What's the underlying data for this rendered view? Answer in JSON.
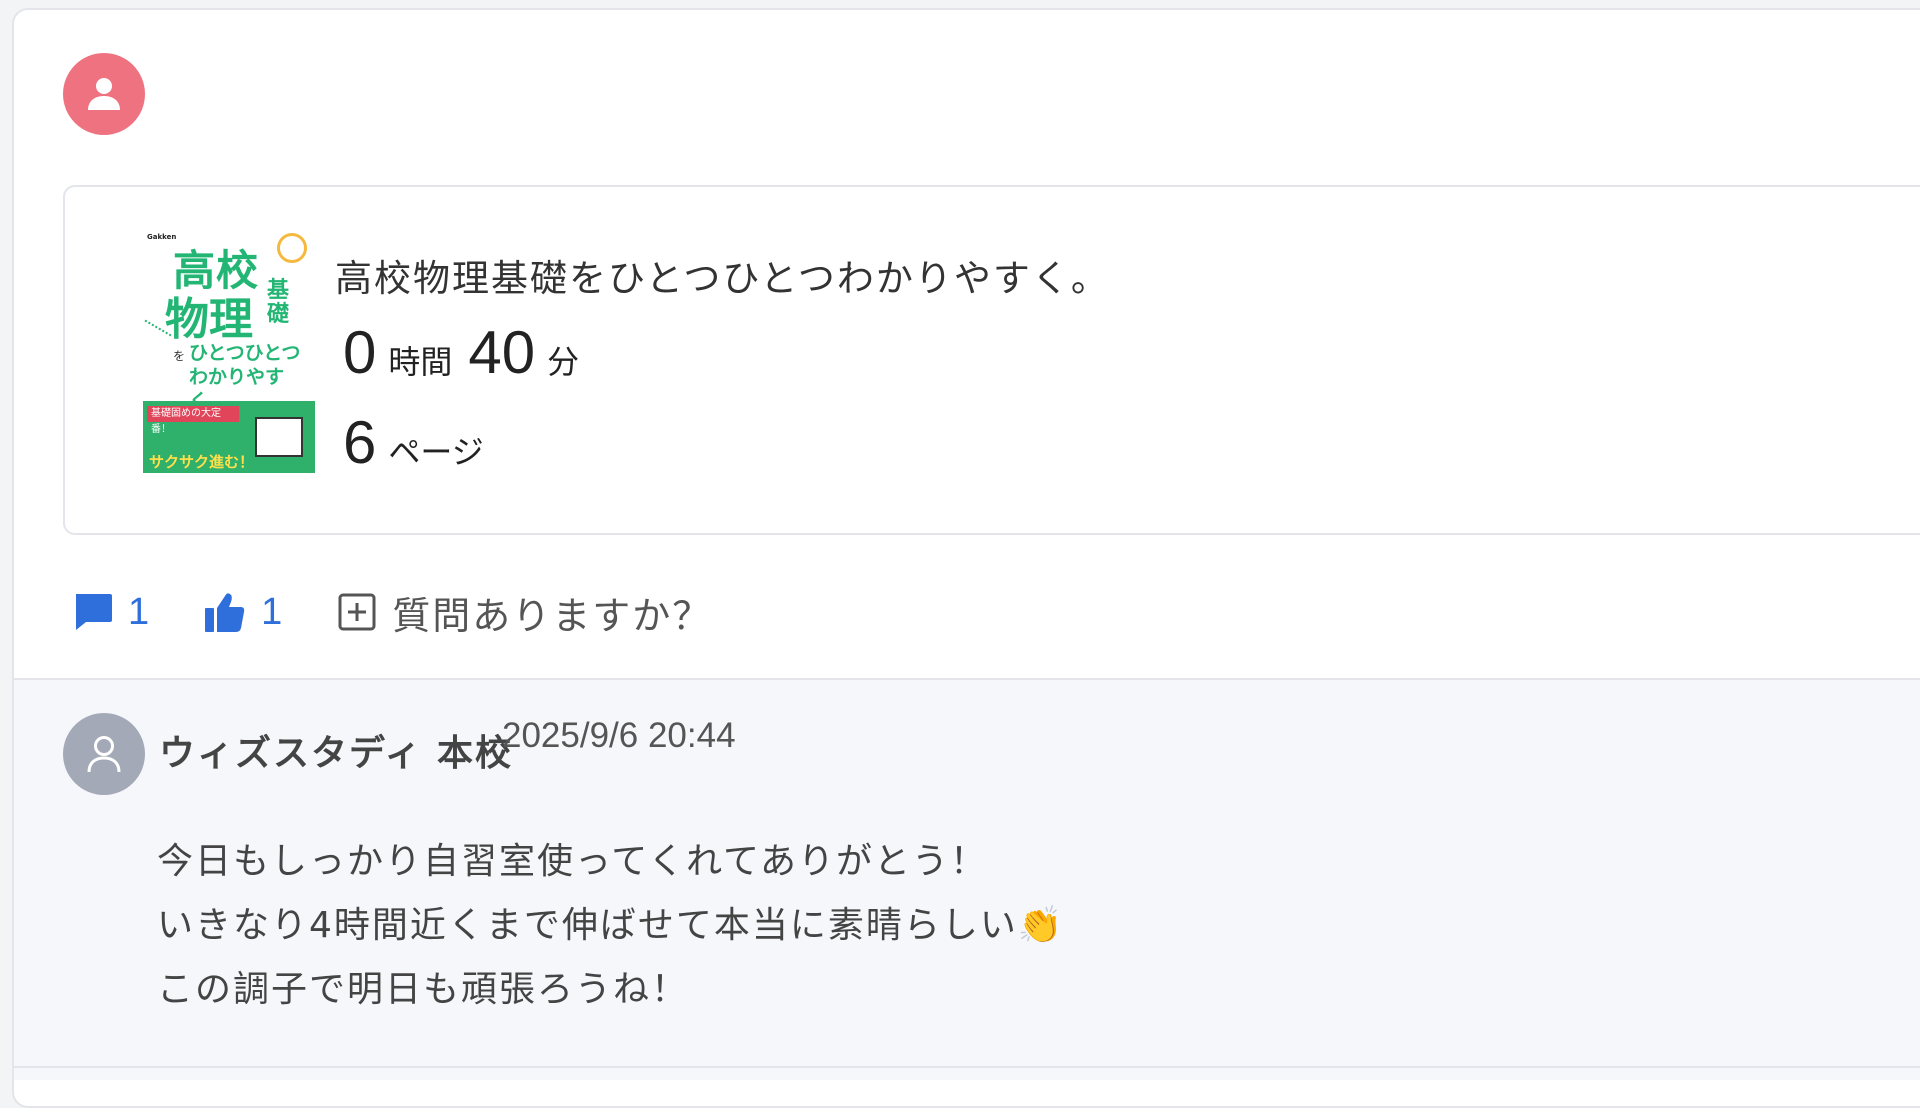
{
  "post": {
    "avatar_icon": "user-icon",
    "avatar_color": "#ee7280"
  },
  "record": {
    "book_cover": {
      "publisher": "Gakken",
      "title_line1": "高校",
      "title_line2": "物理",
      "title_suffix": "基礎",
      "particle": "を",
      "subtitle_line1": "ひとつひとつ",
      "subtitle_line2": "わかりやすく。",
      "band_tag": "基礎固めの大定番！",
      "band_text": "サクサク進む！"
    },
    "book_title": "高校物理基礎をひとつひとつわかりやすく。",
    "hours": "0",
    "hours_unit": "時間",
    "minutes": "40",
    "minutes_unit": "分",
    "pages": "6",
    "pages_unit": "ページ"
  },
  "actions": {
    "comment_icon": "comment-icon",
    "comment_count": "1",
    "like_icon": "thumbs-up-icon",
    "like_count": "1",
    "ask_icon": "plus-square-icon",
    "ask_label": "質問ありますか？",
    "accent_color": "#2f6fdb"
  },
  "comment": {
    "avatar_icon": "user-outline-icon",
    "author": "ウィズスタディ 本校",
    "timestamp": "2025/9/6 20:44",
    "body_line1": "今日もしっかり自習室使ってくれてありがとう！",
    "body_line2": "いきなり4時間近くまで伸ばせて本当に素晴らしい👏",
    "body_line3": "この調子で明日も頑張ろうね！"
  }
}
